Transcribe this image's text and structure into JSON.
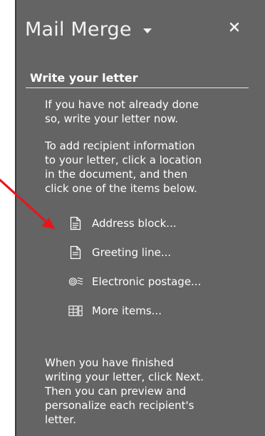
{
  "pane": {
    "title": "Mail Merge"
  },
  "section": {
    "heading": "Write your letter"
  },
  "intro_lines": [
    "If you have not already done",
    "so, write your letter now."
  ],
  "instruction_lines": [
    "To add recipient information",
    "to your letter, click a location",
    "in the document, and then",
    "click one of the items below."
  ],
  "items": [
    {
      "label": "Address block...",
      "icon": "document-page-icon"
    },
    {
      "label": "Greeting line...",
      "icon": "document-page-icon"
    },
    {
      "label": "Electronic postage...",
      "icon": "postage-stamp-icon"
    },
    {
      "label": "More items...",
      "icon": "table-grid-icon"
    }
  ],
  "outro_lines": [
    "When you have finished",
    "writing your letter, click Next.",
    "Then you can preview and",
    "personalize each recipient's",
    "letter."
  ],
  "colors": {
    "pane_background": "#646464",
    "text": "#ffffff",
    "annotation_arrow": "#e8141c"
  }
}
